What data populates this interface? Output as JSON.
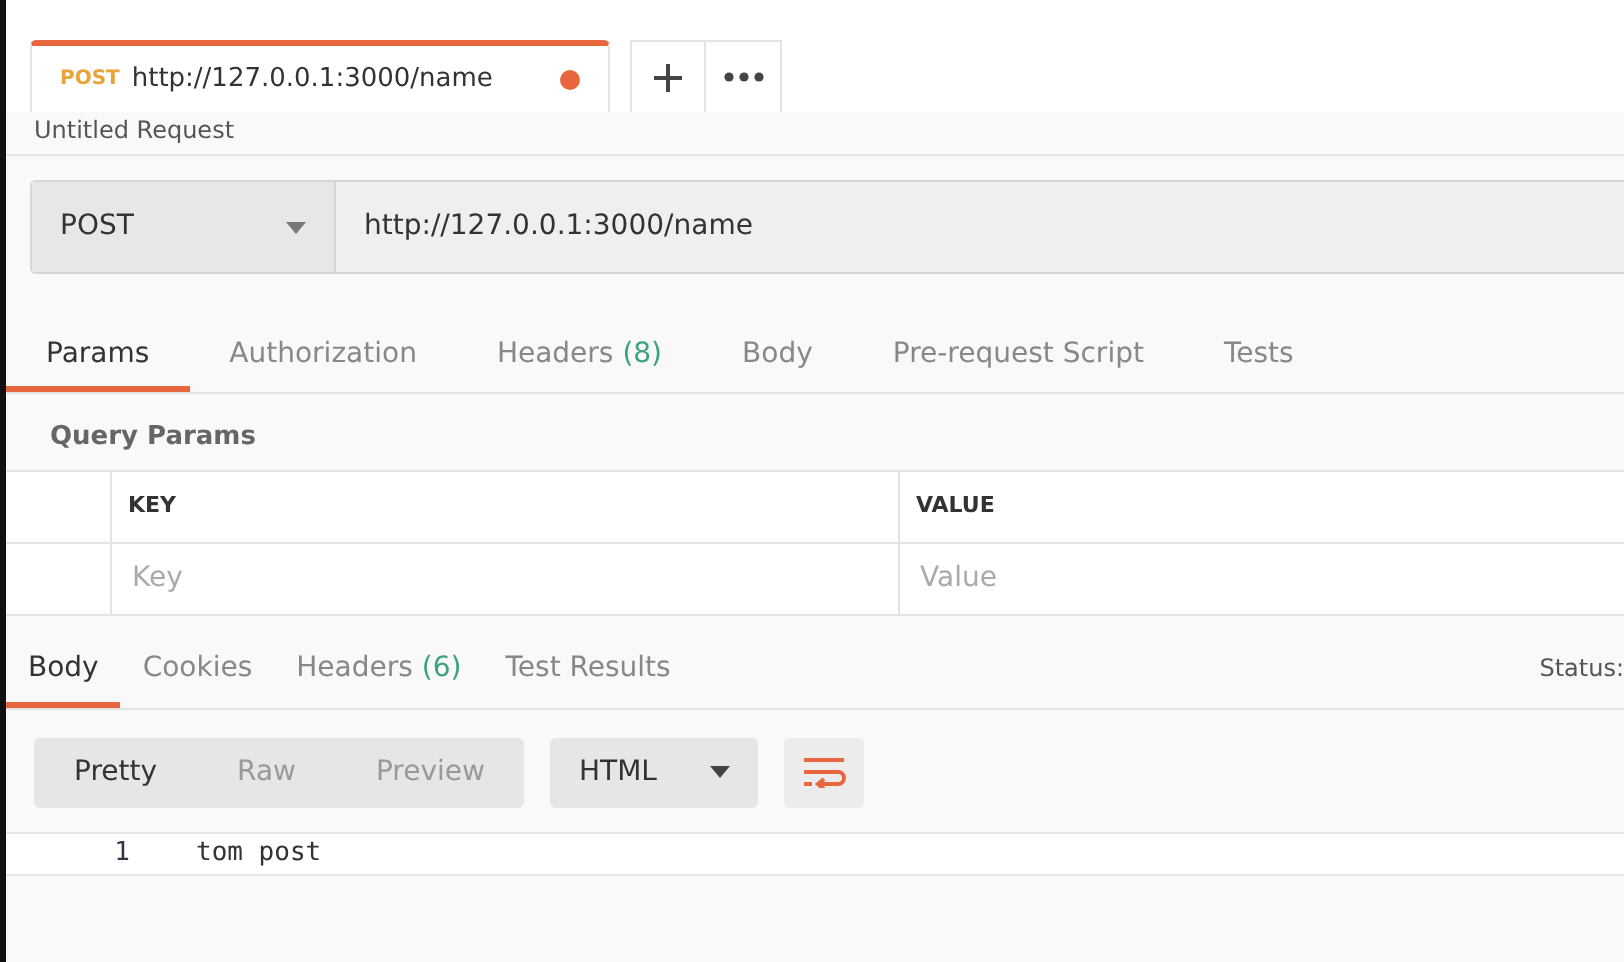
{
  "open_tabs": [
    {
      "method": "POST",
      "url": "http://127.0.0.1:3000/name",
      "unsaved": true,
      "selected": true
    }
  ],
  "title": "Untitled Request",
  "request": {
    "method": "POST",
    "url": "http://127.0.0.1:3000/name"
  },
  "request_tabs": [
    {
      "label": "Params",
      "selected": true
    },
    {
      "label": "Authorization",
      "selected": false
    },
    {
      "label": "Headers",
      "count": "(8)",
      "selected": false
    },
    {
      "label": "Body",
      "selected": false
    },
    {
      "label": "Pre-request Script",
      "selected": false
    },
    {
      "label": "Tests",
      "selected": false
    }
  ],
  "query_params": {
    "title": "Query Params",
    "columns": [
      "KEY",
      "VALUE"
    ],
    "rows": [
      {
        "key_placeholder": "Key",
        "value_placeholder": "Value"
      }
    ]
  },
  "response": {
    "tabs": [
      {
        "label": "Body",
        "selected": true
      },
      {
        "label": "Cookies",
        "selected": false
      },
      {
        "label": "Headers",
        "count": "(6)",
        "selected": false
      },
      {
        "label": "Test Results",
        "selected": false
      }
    ],
    "status_label": "Status:",
    "view_modes": [
      {
        "label": "Pretty",
        "selected": true
      },
      {
        "label": "Raw",
        "selected": false
      },
      {
        "label": "Preview",
        "selected": false
      }
    ],
    "format": "HTML",
    "wrap_lines": true,
    "lines": [
      {
        "number": "1",
        "text": "tom post"
      }
    ]
  }
}
